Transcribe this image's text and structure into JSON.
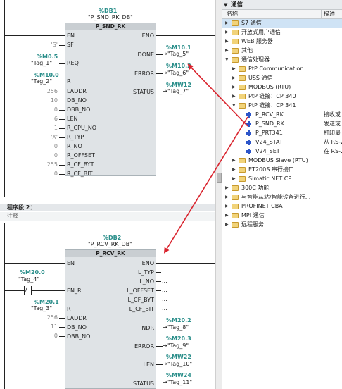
{
  "net1": {
    "db": "%DB1",
    "db_name": "\"P_SND_RK_DB\"",
    "block": "P_SND_RK",
    "en": "EN",
    "eno": "ENO",
    "inputs": [
      {
        "addr": "",
        "tag": "'S'",
        "pin": "SF"
      },
      {
        "addr": "%M0.5",
        "tag": "\"Tag_1\"",
        "pin": "REQ"
      },
      {
        "addr": "%M10.0",
        "tag": "\"Tag_2\"",
        "pin": "R"
      },
      {
        "addr": "",
        "tag": "256",
        "pin": "LADDR"
      },
      {
        "addr": "",
        "tag": "10",
        "pin": "DB_NO"
      },
      {
        "addr": "",
        "tag": "0",
        "pin": "DBB_NO"
      },
      {
        "addr": "",
        "tag": "6",
        "pin": "LEN"
      },
      {
        "addr": "",
        "tag": "1",
        "pin": "R_CPU_NO"
      },
      {
        "addr": "",
        "tag": "'X'",
        "pin": "R_TYP"
      },
      {
        "addr": "",
        "tag": "0",
        "pin": "R_NO"
      },
      {
        "addr": "",
        "tag": "0",
        "pin": "R_OFFSET"
      },
      {
        "addr": "",
        "tag": "255",
        "pin": "R_CF_BYT"
      },
      {
        "addr": "",
        "tag": "0",
        "pin": "R_CF_BIT"
      }
    ],
    "outputs": [
      {
        "pin": "DONE",
        "addr": "%M10.1",
        "tag": "\"Tag_5\""
      },
      {
        "pin": "ERROR",
        "addr": "%M10.2",
        "tag": "\"Tag_6\""
      },
      {
        "pin": "STATUS",
        "addr": "%MW12",
        "tag": "\"Tag_7\""
      }
    ]
  },
  "segment2": {
    "title": "程序段 2：",
    "dots": "......",
    "comment": "注释"
  },
  "net2": {
    "db": "%DB2",
    "db_name": "\"P_RCV_RK_DB\"",
    "block": "P_RCV_RK",
    "en": "EN",
    "eno": "ENO",
    "contact_addr": "%M20.0",
    "contact_tag": "\"Tag_4\"",
    "inputs": [
      {
        "addr": "",
        "tag": "",
        "pin": "EN_R"
      },
      {
        "addr": "%M20.1",
        "tag": "\"Tag_3\"",
        "pin": "R"
      },
      {
        "addr": "",
        "tag": "256",
        "pin": "LADDR"
      },
      {
        "addr": "",
        "tag": "11",
        "pin": "DB_NO"
      },
      {
        "addr": "",
        "tag": "0",
        "pin": "DBB_NO"
      }
    ],
    "outputs_empty": [
      {
        "pin": "L_TYP",
        "val": "..."
      },
      {
        "pin": "L_NO",
        "val": "..."
      },
      {
        "pin": "L_OFFSET",
        "val": "..."
      },
      {
        "pin": "L_CF_BYT",
        "val": "..."
      },
      {
        "pin": "L_CF_BIT",
        "val": "..."
      }
    ],
    "outputs": [
      {
        "pin": "NDR",
        "addr": "%M20.2",
        "tag": "\"Tag_8\""
      },
      {
        "pin": "ERROR",
        "addr": "%M20.3",
        "tag": "\"Tag_9\""
      },
      {
        "pin": "LEN",
        "addr": "%MW22",
        "tag": "\"Tag_10\""
      },
      {
        "pin": "STATUS",
        "addr": "%MW24",
        "tag": "\"Tag_11\""
      }
    ]
  },
  "panel": {
    "title": "通信",
    "col_name": "名称",
    "col_desc": "描述",
    "tree": [
      {
        "label": "S7 通信",
        "type": "folder",
        "expanded": false,
        "level": 0,
        "desc": "",
        "selected": true
      },
      {
        "label": "开放式用户通信",
        "type": "folder",
        "expanded": false,
        "level": 0,
        "desc": ""
      },
      {
        "label": "WEB 服务器",
        "type": "folder",
        "expanded": false,
        "level": 0,
        "desc": ""
      },
      {
        "label": "其他",
        "type": "folder",
        "expanded": false,
        "level": 0,
        "desc": ""
      },
      {
        "label": "通信处理器",
        "type": "folder",
        "expanded": true,
        "level": 0,
        "desc": ""
      },
      {
        "label": "PtP Communication",
        "type": "folder",
        "expanded": false,
        "level": 1,
        "desc": ""
      },
      {
        "label": "USS 通信",
        "type": "folder",
        "expanded": false,
        "level": 1,
        "desc": ""
      },
      {
        "label": "MODBUS (RTU)",
        "type": "folder",
        "expanded": false,
        "level": 1,
        "desc": ""
      },
      {
        "label": "PtP 链接：CP 340",
        "type": "folder",
        "expanded": false,
        "level": 1,
        "desc": ""
      },
      {
        "label": "PtP 链接：CP 341",
        "type": "folder",
        "expanded": true,
        "level": 1,
        "desc": ""
      },
      {
        "label": "P_RCV_RK",
        "type": "block",
        "level": 2,
        "desc": "接收或"
      },
      {
        "label": "P_SND_RK",
        "type": "block",
        "level": 2,
        "desc": "发送或"
      },
      {
        "label": "P_PRT341",
        "type": "block",
        "level": 2,
        "desc": "打印最"
      },
      {
        "label": "V24_STAT",
        "type": "block",
        "level": 2,
        "desc": "从 RS-2"
      },
      {
        "label": "V24_SET",
        "type": "block",
        "level": 2,
        "desc": "在 RS-2"
      },
      {
        "label": "MODBUS Slave (RTU)",
        "type": "folder",
        "expanded": false,
        "level": 1,
        "desc": ""
      },
      {
        "label": "ET200S 串行接口",
        "type": "folder",
        "expanded": false,
        "level": 1,
        "desc": ""
      },
      {
        "label": "Simatic NET CP",
        "type": "folder",
        "expanded": false,
        "level": 1,
        "desc": ""
      },
      {
        "label": "300C 功能",
        "type": "folder",
        "expanded": false,
        "level": 0,
        "desc": ""
      },
      {
        "label": "与智能从站/智能设备进行...",
        "type": "folder",
        "expanded": false,
        "level": 0,
        "desc": ""
      },
      {
        "label": "PROFINET CBA",
        "type": "folder",
        "expanded": false,
        "level": 0,
        "desc": ""
      },
      {
        "label": "MPI 通信",
        "type": "folder",
        "expanded": false,
        "level": 0,
        "desc": ""
      },
      {
        "label": "远程服务",
        "type": "folder",
        "expanded": false,
        "level": 0,
        "desc": ""
      }
    ]
  },
  "colors": {
    "teal": "#2a8e8a",
    "arrow": "#d9232d",
    "selection": "#cfe3f5",
    "block_body": "#dfe3e6"
  }
}
